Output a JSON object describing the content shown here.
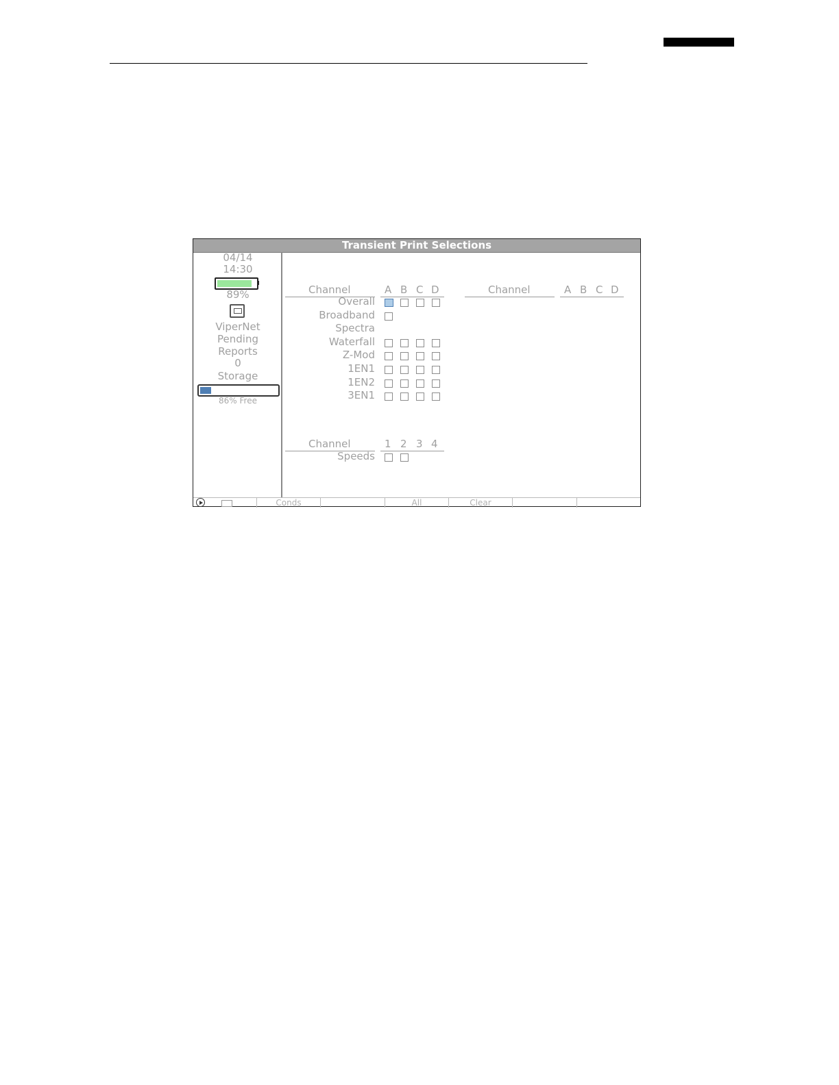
{
  "screen": {
    "title": "Transient Print Selections",
    "sidebar": {
      "date": "04/14",
      "time": "14:30",
      "battery_percent_label": "89%",
      "battery_level": 0.89,
      "network_label": "ViperNet",
      "pending_label": "Pending",
      "reports_label": "Reports",
      "reports_count": "0",
      "storage_label": "Storage",
      "storage_free_label": "86% Free",
      "storage_used_fraction": 0.14
    },
    "table1": {
      "header": "Channel",
      "columns": [
        "A",
        "B",
        "C",
        "D"
      ],
      "rows": [
        {
          "label": "Overall",
          "boxes": [
            true,
            false,
            false,
            false
          ]
        },
        {
          "label": "Broadband",
          "boxes": [
            false
          ]
        },
        {
          "label": "Spectra",
          "boxes": []
        },
        {
          "label": "Waterfall",
          "boxes": [
            false,
            false,
            false,
            false
          ]
        },
        {
          "label": "Z-Mod",
          "boxes": [
            false,
            false,
            false,
            false
          ]
        },
        {
          "label": "1EN1",
          "boxes": [
            false,
            false,
            false,
            false
          ]
        },
        {
          "label": "1EN2",
          "boxes": [
            false,
            false,
            false,
            false
          ]
        },
        {
          "label": "3EN1",
          "boxes": [
            false,
            false,
            false,
            false
          ]
        }
      ]
    },
    "table2": {
      "header": "Channel",
      "columns": [
        "A",
        "B",
        "C",
        "D"
      ]
    },
    "table3": {
      "header": "Channel",
      "columns": [
        "1",
        "2",
        "3",
        "4"
      ],
      "rows": [
        {
          "label": "Speeds",
          "boxes": [
            false,
            false
          ]
        }
      ]
    },
    "softkeys": [
      "",
      "Conds",
      "",
      "All",
      "Clear",
      "",
      ""
    ],
    "softkey_icons": [
      "backspace-icon"
    ]
  }
}
